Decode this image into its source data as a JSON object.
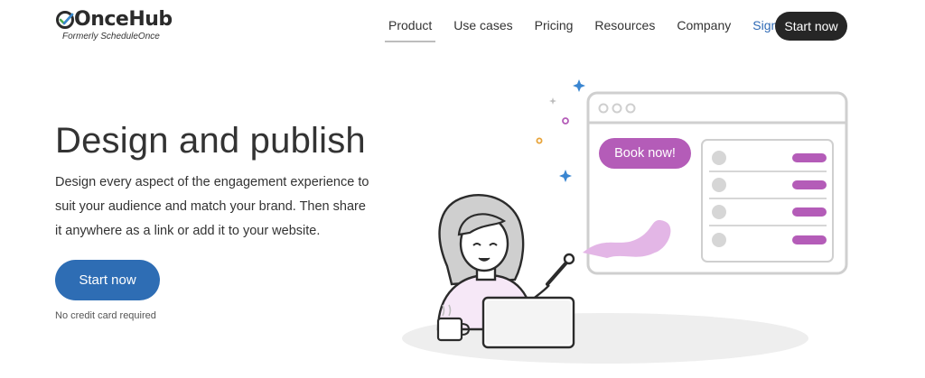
{
  "brand": {
    "name": "OnceHub",
    "tagline": "Formerly ScheduleOnce"
  },
  "nav": {
    "items": [
      {
        "label": "Product",
        "active": true
      },
      {
        "label": "Use cases",
        "active": false
      },
      {
        "label": "Pricing",
        "active": false
      },
      {
        "label": "Resources",
        "active": false
      },
      {
        "label": "Company",
        "active": false
      }
    ],
    "signin_label": "Sign In",
    "cta_label": "Start now"
  },
  "hero": {
    "title": "Design and publish",
    "description": "Design every aspect of the engagement experience to suit your audience and match your brand. Then share it anywhere as a link or add it to your website.",
    "cta_label": "Start now",
    "note": "No credit card required"
  },
  "illustration": {
    "book_button_label": "Book now!",
    "colors": {
      "accent": "#b45cb8",
      "accent_light": "#e3b6e6",
      "frame": "#cfcfcf",
      "dark": "#2b2b2b",
      "sparkle_blue": "#3a86d1",
      "sparkle_orange": "#e8a43a"
    }
  },
  "colors": {
    "primary": "#2e6db4",
    "dark_button": "#262626",
    "signin_link": "#2f6ab5"
  }
}
